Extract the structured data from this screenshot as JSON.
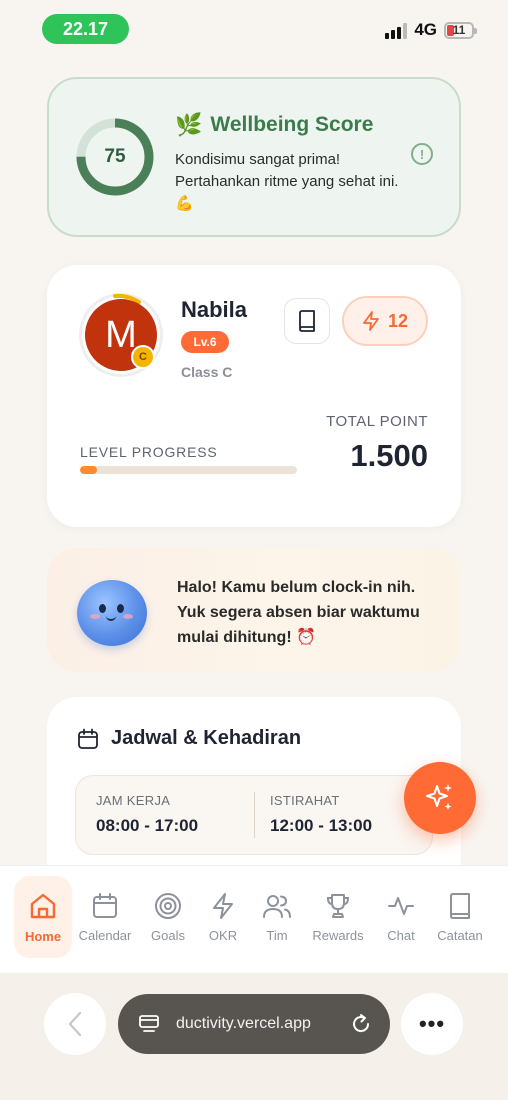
{
  "status_bar": {
    "time": "22.17",
    "network": "4G",
    "battery": "11"
  },
  "wellbeing": {
    "score": "75",
    "score_fraction": 0.75,
    "title": "Wellbeing Score",
    "leaf_emoji": "🌿",
    "description": "Kondisimu sangat prima! Pertahankan ritme yang sehat ini. 💪",
    "info_symbol": "!"
  },
  "profile": {
    "avatar_initial": "M",
    "avatar_badge": "C",
    "name": "Nabila",
    "level": "Lv.6",
    "class_label": "Class C",
    "streak": "12",
    "total_point_label": "TOTAL POINT",
    "total_point_value": "1.500",
    "level_progress_label": "LEVEL PROGRESS",
    "level_progress_fraction": 0.08
  },
  "clock_in": {
    "message": "Halo! Kamu belum clock-in nih. Yuk segera absen biar waktumu mulai dihitung! ⏰"
  },
  "schedule": {
    "title": "Jadwal & Kehadiran",
    "work_label": "JAM KERJA",
    "work_value": "08:00 - 17:00",
    "break_label": "ISTIRAHAT",
    "break_value": "12:00 - 13:00"
  },
  "nav": {
    "items": [
      {
        "label": "Home",
        "icon": "home-icon"
      },
      {
        "label": "Calendar",
        "icon": "calendar-icon"
      },
      {
        "label": "Goals",
        "icon": "target-icon"
      },
      {
        "label": "OKR",
        "icon": "lightning-icon"
      },
      {
        "label": "Tim",
        "icon": "users-icon"
      },
      {
        "label": "Rewards",
        "icon": "trophy-icon"
      },
      {
        "label": "Chat",
        "icon": "pulse-icon"
      },
      {
        "label": "Catatan",
        "icon": "book-icon"
      }
    ]
  },
  "browser": {
    "url": "ductivity.vercel.app",
    "more": "•••"
  },
  "colors": {
    "accent": "#ff6a35",
    "green": "#3d7a4c",
    "active_bg": "#fff0e8"
  }
}
